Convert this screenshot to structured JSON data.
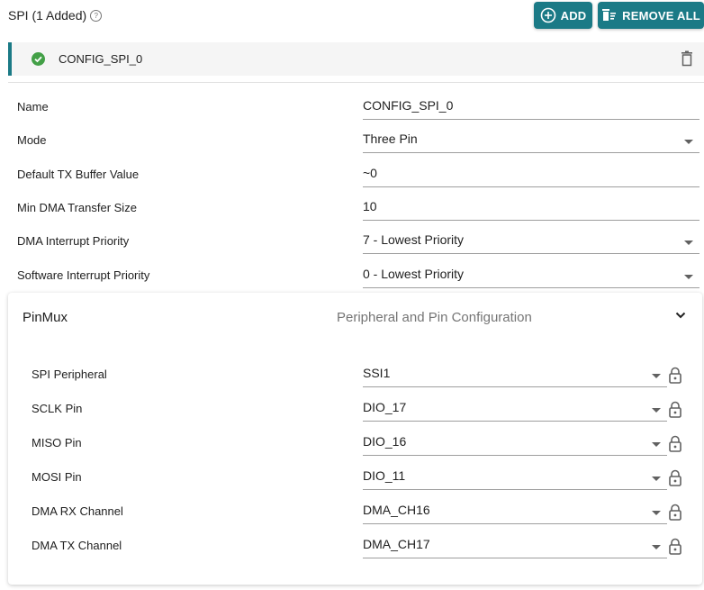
{
  "header": {
    "title": "SPI (1 Added)",
    "add_label": "ADD",
    "remove_all_label": "REMOVE ALL"
  },
  "instance": {
    "name": "CONFIG_SPI_0",
    "status": "valid"
  },
  "fields": [
    {
      "label": "Name",
      "value": "CONFIG_SPI_0",
      "type": "text"
    },
    {
      "label": "Mode",
      "value": "Three Pin",
      "type": "select"
    },
    {
      "label": "Default TX Buffer Value",
      "value": "~0",
      "type": "text"
    },
    {
      "label": "Min DMA Transfer Size",
      "value": "10",
      "type": "text"
    },
    {
      "label": "DMA Interrupt Priority",
      "value": "7 - Lowest Priority",
      "type": "select"
    },
    {
      "label": "Software Interrupt Priority",
      "value": "0 - Lowest Priority",
      "type": "select"
    }
  ],
  "pinmux": {
    "title": "PinMux",
    "subtitle": "Peripheral and Pin Configuration",
    "expanded": true,
    "rows": [
      {
        "label": "SPI Peripheral",
        "value": "SSI1"
      },
      {
        "label": "SCLK Pin",
        "value": "DIO_17"
      },
      {
        "label": "MISO Pin",
        "value": "DIO_16"
      },
      {
        "label": "MOSI Pin",
        "value": "DIO_11"
      },
      {
        "label": "DMA RX Channel",
        "value": "DMA_CH16"
      },
      {
        "label": "DMA TX Channel",
        "value": "DMA_CH17"
      }
    ]
  },
  "colors": {
    "accent": "#1b7a86",
    "success": "#43a047"
  }
}
